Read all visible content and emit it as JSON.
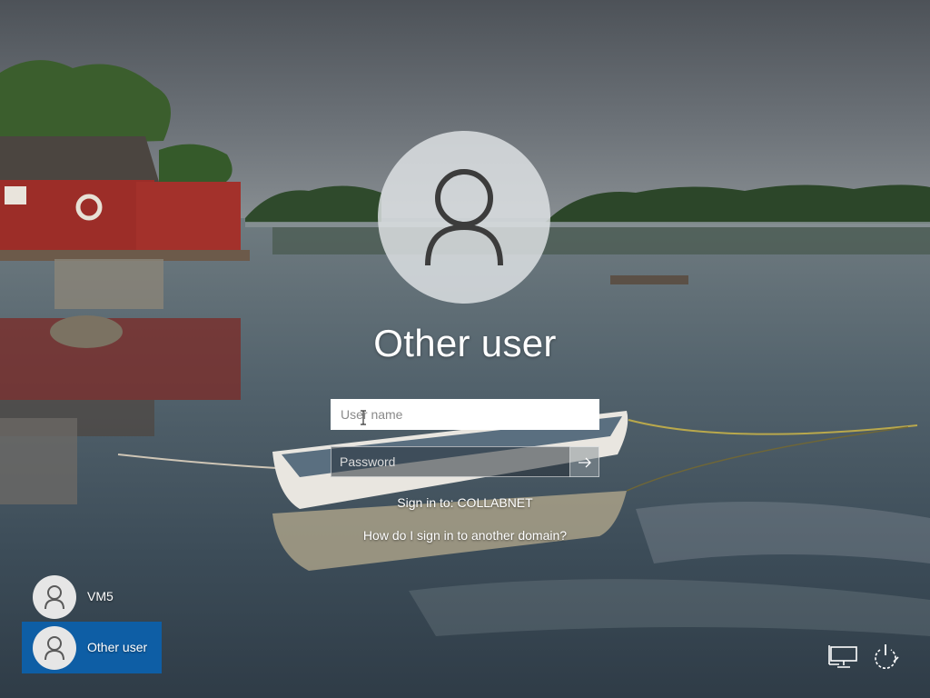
{
  "login": {
    "account_name": "Other user",
    "username_placeholder": "User name",
    "username_value": "",
    "password_placeholder": "Password",
    "password_value": "",
    "submit_icon": "arrow-right-icon",
    "sign_in_to": "Sign in to: COLLABNET",
    "domain_help_link": "How do I sign in to another domain?"
  },
  "user_list": [
    {
      "label": "VM5",
      "selected": false,
      "icon": "user-avatar-icon"
    },
    {
      "label": "Other user",
      "selected": true,
      "icon": "user-avatar-icon"
    }
  ],
  "system_buttons": [
    {
      "name": "network",
      "icon": "network-icon"
    },
    {
      "name": "power",
      "icon": "power-icon"
    }
  ],
  "colors": {
    "selected_tile": "#0e5ea5",
    "text": "#ffffff",
    "avatar_circle": "#e1e4e6",
    "avatar_glyph": "#3c3c3c"
  },
  "wallpaper": {
    "description": "lake with red boathouse and white rowboat"
  }
}
